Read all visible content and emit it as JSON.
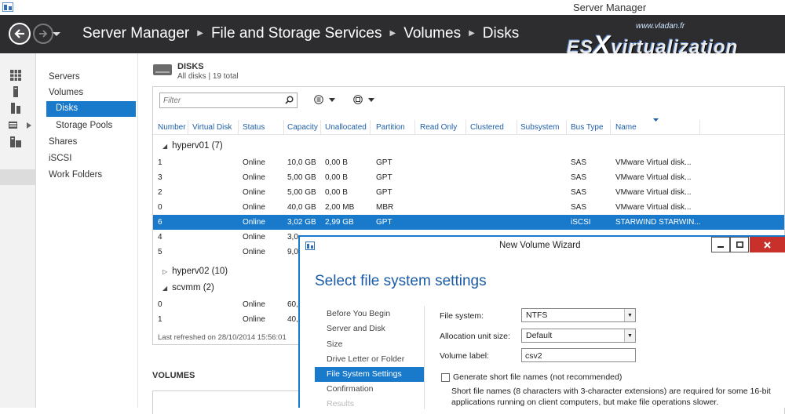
{
  "window": {
    "title": "Server Manager"
  },
  "watermark": {
    "url": "www.vladan.fr",
    "logo_es": "ES",
    "logo_x": "X",
    "logo_rest": "virtualization"
  },
  "breadcrumb": [
    "Server Manager",
    "File and Storage Services",
    "Volumes",
    "Disks"
  ],
  "tree": {
    "items": [
      "Servers",
      "Volumes",
      "Disks",
      "Storage Pools",
      "Shares",
      "iSCSI",
      "Work Folders"
    ]
  },
  "disks": {
    "title": "DISKS",
    "subtitle": "All disks | 19 total",
    "filter_placeholder": "Filter",
    "columns": [
      "Number",
      "Virtual Disk",
      "Status",
      "Capacity",
      "Unallocated",
      "Partition",
      "Read Only",
      "Clustered",
      "Subsystem",
      "Bus Type",
      "Name"
    ],
    "groups": [
      {
        "label": "hyperv01 (7)",
        "expanded": true
      },
      {
        "label": "hyperv02 (10)",
        "expanded": false
      },
      {
        "label": "scvmm (2)",
        "expanded": true
      }
    ],
    "rows": [
      {
        "number": "1",
        "status": "Online",
        "capacity": "10,0 GB",
        "unallocated": "0,00 B",
        "partition": "GPT",
        "bus": "SAS",
        "name": "VMware Virtual disk..."
      },
      {
        "number": "3",
        "status": "Online",
        "capacity": "5,00 GB",
        "unallocated": "0,00 B",
        "partition": "GPT",
        "bus": "SAS",
        "name": "VMware Virtual disk..."
      },
      {
        "number": "2",
        "status": "Online",
        "capacity": "5,00 GB",
        "unallocated": "0,00 B",
        "partition": "GPT",
        "bus": "SAS",
        "name": "VMware Virtual disk..."
      },
      {
        "number": "0",
        "status": "Online",
        "capacity": "40,0 GB",
        "unallocated": "2,00 MB",
        "partition": "MBR",
        "bus": "SAS",
        "name": "VMware Virtual disk..."
      },
      {
        "number": "6",
        "status": "Online",
        "capacity": "3,02 GB",
        "unallocated": "2,99 GB",
        "partition": "GPT",
        "bus": "iSCSI",
        "name": "STARWIND STARWIN..."
      },
      {
        "number": "4",
        "status": "Online",
        "capacity": "3,0"
      },
      {
        "number": "5",
        "status": "Online",
        "capacity": "9,0"
      },
      {
        "number": "0",
        "status": "Online",
        "capacity": "60,"
      },
      {
        "number": "1",
        "status": "Online",
        "capacity": "40,"
      }
    ],
    "last_refreshed": "Last refreshed on 28/10/2014 15:56:01"
  },
  "volumes": {
    "title": "VOLUMES"
  },
  "wizard": {
    "title": "New Volume Wizard",
    "heading": "Select file system settings",
    "steps": [
      "Before You Begin",
      "Server and Disk",
      "Size",
      "Drive Letter or Folder",
      "File System Settings",
      "Confirmation",
      "Results"
    ],
    "file_system_label": "File system:",
    "file_system_value": "NTFS",
    "alloc_label": "Allocation unit size:",
    "alloc_value": "Default",
    "volume_label_label": "Volume label:",
    "volume_label_value": "csv2",
    "shortnames_label": "Generate short file names (not recommended)",
    "shortnames_desc": "Short file names (8 characters with 3-character extensions) are required for some 16-bit applications running on client computers, but make file operations slower."
  }
}
